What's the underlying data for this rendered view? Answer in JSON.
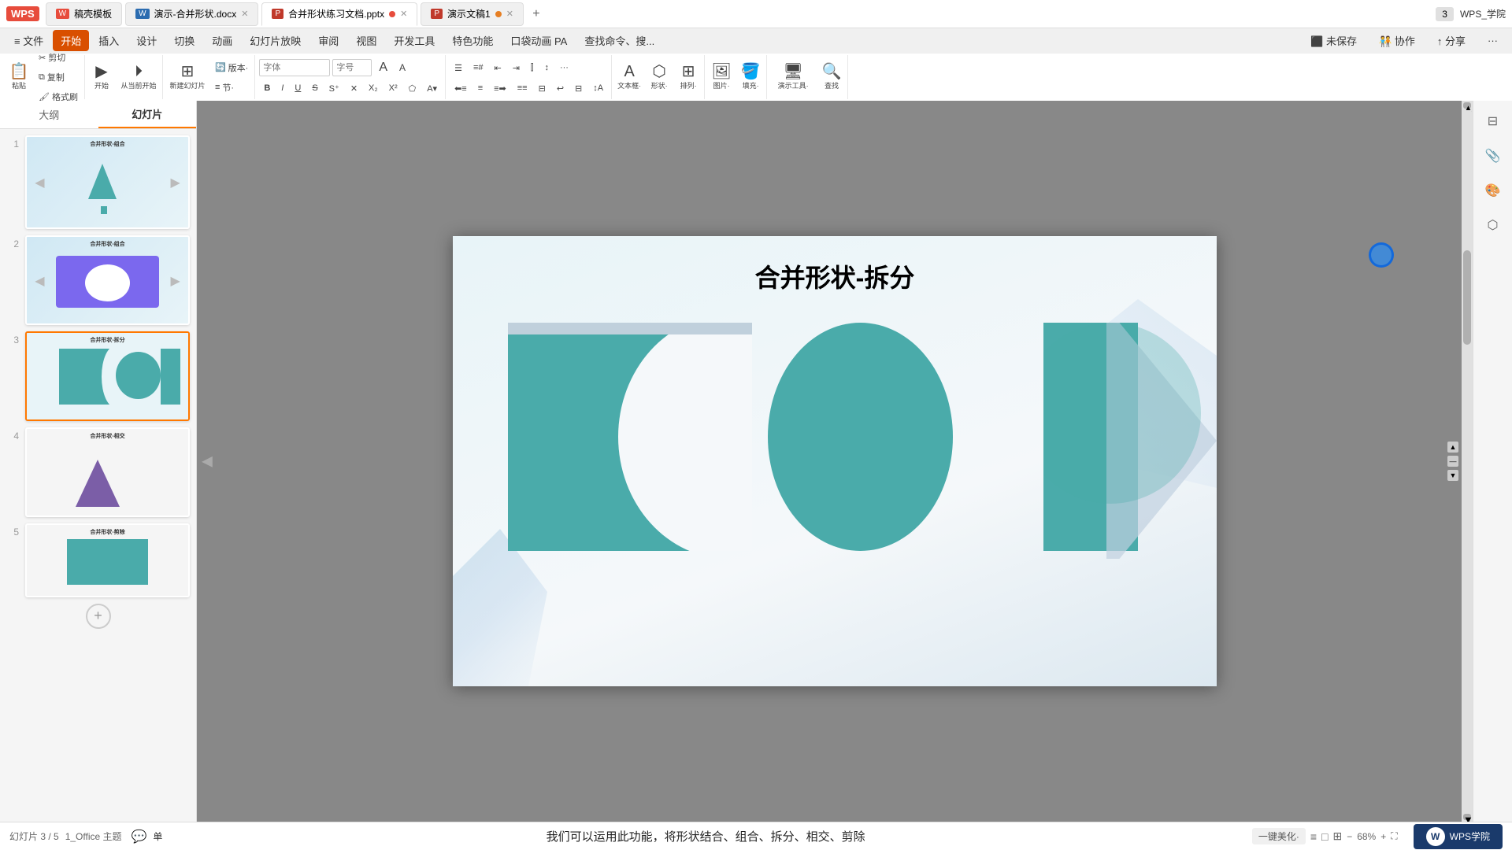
{
  "titlebar": {
    "wps_label": "WPS",
    "tabs": [
      {
        "id": "template",
        "icon": "W",
        "label": "稿壳模板",
        "closable": false,
        "active": false
      },
      {
        "id": "word",
        "icon": "W",
        "label": "演示-合并形状.docx",
        "closable": true,
        "active": false,
        "dot": false
      },
      {
        "id": "pptx",
        "icon": "P",
        "label": "合并形状练习文档.pptx",
        "closable": true,
        "active": true,
        "dot": true
      },
      {
        "id": "ppt2",
        "icon": "P",
        "label": "演示文稿1",
        "closable": true,
        "active": false,
        "dot": true
      }
    ],
    "new_tab": "+",
    "right_num": "3",
    "right_user": "WPS_学院"
  },
  "menubar": {
    "items": [
      "≡ 文件",
      "开始",
      "插入",
      "设计",
      "切换",
      "动画",
      "幻灯片放映",
      "审阅",
      "视图",
      "开发工具",
      "特色功能",
      "口袋动画 PA",
      "查找命令、搜...",
      "未保存",
      "协作",
      "分享",
      "···"
    ]
  },
  "toolbar": {
    "paste_label": "粘贴",
    "cut_label": "剪切",
    "copy_label": "复制",
    "format_label": "格式刷",
    "start_label": "开始",
    "from_current_label": "从当前开始",
    "new_slide_label": "新建幻灯片",
    "version_label": "版本·",
    "section_label": "节·",
    "bold": "B",
    "italic": "I",
    "underline": "U",
    "strike": "S",
    "font_name": "",
    "font_size": "",
    "text_frame_label": "文本框·",
    "shape_label": "形状·",
    "arrange_label": "排列·",
    "present_tool_label": "演示工具·",
    "search_label": "查找命令、搜..."
  },
  "panel": {
    "tab_outline": "大纲",
    "tab_slides": "幻灯片"
  },
  "slides": [
    {
      "id": 1,
      "title": "合并形状-组合",
      "active": false
    },
    {
      "id": 2,
      "title": "合并形状-组合",
      "active": false
    },
    {
      "id": 3,
      "title": "合并形状-拆分",
      "active": true
    },
    {
      "id": 4,
      "title": "合并形状-相交",
      "active": false
    },
    {
      "id": 5,
      "title": "合并形状-剪除",
      "active": false
    }
  ],
  "canvas": {
    "title": "合并形状-拆分",
    "zoom": "68%"
  },
  "bottombar": {
    "slide_count": "幻灯片 3 / 5",
    "theme": "1_Office 主题",
    "caption_icon": "💬",
    "caption_label": "单",
    "caption_text": "我们可以运用此功能，将形状结合、组合、拆分、相交、剪除",
    "beautify_label": "一键美化·",
    "layout_icons": "≡ □ □",
    "zoom_minus": "−",
    "zoom_value": "68%",
    "zoom_plus": "+",
    "zoom_fit": "⛶",
    "wps_promo_name": "WPS学院"
  },
  "cursor": {
    "visible": true
  },
  "colors": {
    "teal": "#4aabaa",
    "purple": "#7b68ee",
    "dark_purple": "#7b5ea7",
    "orange": "#e67e22",
    "red_dot": "#e74c3c",
    "orange_dot": "#e67e22"
  }
}
